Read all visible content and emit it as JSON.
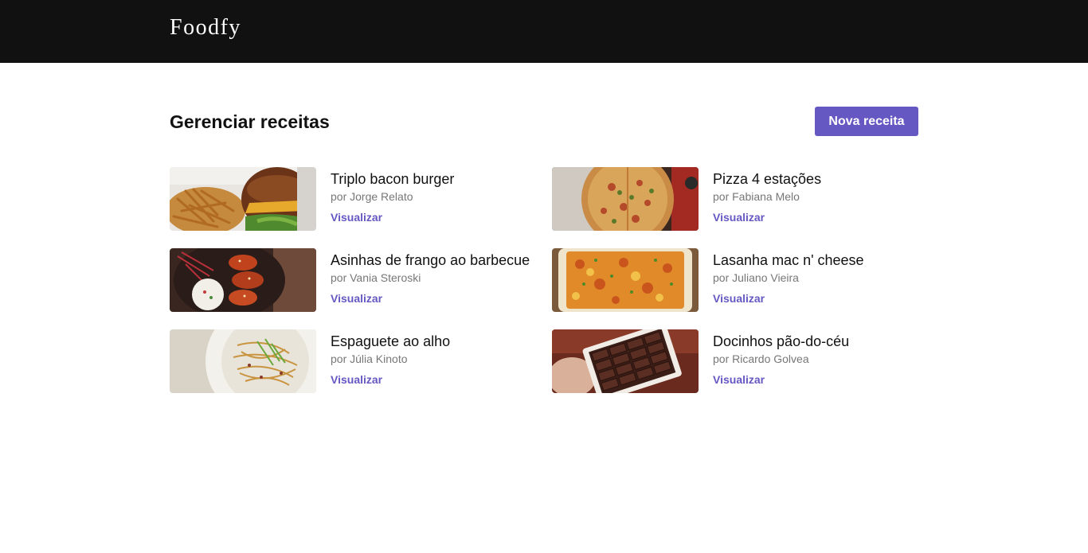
{
  "header": {
    "logo": "Foodfy"
  },
  "main": {
    "title": "Gerenciar receitas",
    "new_button_label": "Nova receita"
  },
  "recipes": [
    {
      "title": "Triplo bacon burger",
      "author": "por Jorge Relato",
      "link_label": "Visualizar",
      "image": "burger-image"
    },
    {
      "title": "Pizza 4 estações",
      "author": "por Fabiana Melo",
      "link_label": "Visualizar",
      "image": "pizza-image"
    },
    {
      "title": "Asinhas de frango ao barbecue",
      "author": "por Vania Steroski",
      "link_label": "Visualizar",
      "image": "chicken-wings-image"
    },
    {
      "title": "Lasanha mac n' cheese",
      "author": "por Juliano Vieira",
      "link_label": "Visualizar",
      "image": "lasagna-image"
    },
    {
      "title": "Espaguete ao alho",
      "author": "por Júlia Kinoto",
      "link_label": "Visualizar",
      "image": "spaghetti-image"
    },
    {
      "title": "Docinhos pão-do-céu",
      "author": "por Ricardo Golvea",
      "link_label": "Visualizar",
      "image": "sweets-image"
    }
  ],
  "colors": {
    "topbar": "#111111",
    "accent": "#6558c3",
    "text": "#111111",
    "muted": "#777777"
  }
}
